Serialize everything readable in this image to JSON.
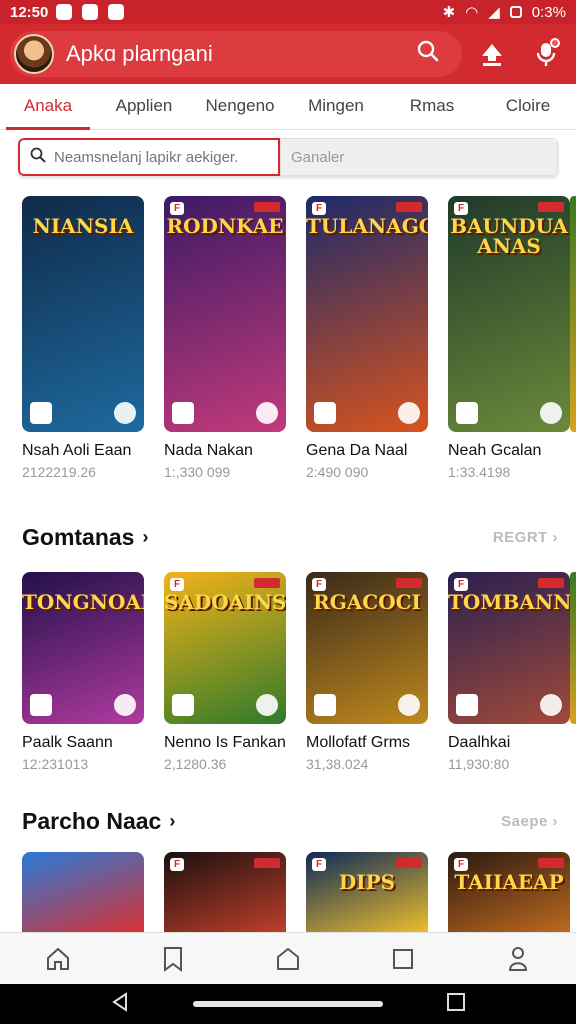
{
  "status_bar": {
    "time": "12:50",
    "battery": "0:3%"
  },
  "header": {
    "title": "Apkɑ plarngani",
    "avatar": "avatar",
    "icons": [
      "search-icon",
      "upload-icon",
      "mic-icon"
    ]
  },
  "tabs": [
    {
      "label": "Anaka",
      "active": true
    },
    {
      "label": "Applien",
      "active": false
    },
    {
      "label": "Nengeno",
      "active": false
    },
    {
      "label": "Mingen",
      "active": false
    },
    {
      "label": "Rmas",
      "active": false
    },
    {
      "label": "Cloire",
      "active": false
    }
  ],
  "search": {
    "placeholder": "Neamsnelanj lapikr aekiger.",
    "filter_label": "Ganaler"
  },
  "row1": {
    "items": [
      {
        "art_title": "NIANSIA",
        "name": "Nsah Aoli Eaan",
        "meta": "2122219.26",
        "colors": [
          "#0f2a4a",
          "#1e6a9e"
        ]
      },
      {
        "art_title": "RODNKAE",
        "name": "Nada Nakan",
        "meta": "1:,330 099",
        "colors": [
          "#3b1a66",
          "#c23a7a"
        ]
      },
      {
        "art_title": "TULANAGON",
        "name": "Gena Da Naal",
        "meta": "2:490 090",
        "colors": [
          "#1c2a6a",
          "#d8541e"
        ]
      },
      {
        "art_title": "BAUNDUA ANAS",
        "name": "Neah Gcalan",
        "meta": "1:33.4198",
        "colors": [
          "#1f3a2a",
          "#6a8a3a"
        ]
      }
    ]
  },
  "section2": {
    "title": "Gomtanas",
    "more": "REGRT"
  },
  "row2": {
    "items": [
      {
        "art_title": "TONGNOAN",
        "name": "Paalk Saann",
        "meta": "12:231013",
        "colors": [
          "#22114a",
          "#b03aa0"
        ]
      },
      {
        "art_title": "SADOAINS",
        "name": "Nenno Is Fankan",
        "meta": "2,1280.36",
        "colors": [
          "#f2b21a",
          "#2f7a2a"
        ]
      },
      {
        "art_title": "RGACOCI",
        "name": "Mollofatf Grms",
        "meta": "31,38.024",
        "colors": [
          "#3a2a1a",
          "#c0891e"
        ]
      },
      {
        "art_title": "TOMBANN",
        "name": "Daalhkai",
        "meta": "11,930:80",
        "colors": [
          "#2a2050",
          "#a04a3a"
        ]
      }
    ]
  },
  "section3": {
    "title": "Parcho Naac",
    "more": "Saepe"
  },
  "row3": {
    "items": [
      {
        "art_title": "",
        "colors": [
          "#2a7ad8",
          "#d93030"
        ]
      },
      {
        "art_title": "",
        "colors": [
          "#1a1010",
          "#c0402a"
        ]
      },
      {
        "art_title": "DIPS",
        "colors": [
          "#0d2a5a",
          "#f0c02a"
        ]
      },
      {
        "art_title": "TAIIAEAP",
        "colors": [
          "#2a1a10",
          "#c06a20"
        ]
      }
    ]
  },
  "bottom_nav": [
    "home-icon",
    "bookmark-icon",
    "house-icon",
    "square-icon",
    "profile-icon"
  ]
}
